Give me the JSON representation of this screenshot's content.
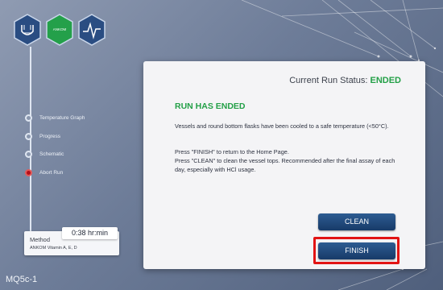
{
  "app": {
    "model": "MQ5c-1",
    "logo_text": "ANKOM"
  },
  "icons": {
    "left": "flask-icon",
    "middle": "ankom-logo-icon",
    "right": "heartbeat-icon"
  },
  "nav": {
    "items": [
      {
        "label": "Temperature Graph",
        "state": "normal"
      },
      {
        "label": "Progress",
        "state": "normal"
      },
      {
        "label": "Schematic",
        "state": "normal"
      },
      {
        "label": "Abort Run",
        "state": "alert"
      }
    ]
  },
  "method": {
    "label": "Method",
    "value": "ANKOM Vitamin A, E, D"
  },
  "time": {
    "value": "0:38 hr:min"
  },
  "panel": {
    "status_label": "Current Run Status:",
    "status_value": "ENDED",
    "title": "RUN HAS ENDED",
    "message_1": "Vessels and round bottom flasks have been cooled to a safe temperature (<50°C).",
    "message_2": "Press \"FINISH\" to return to the Home Page.",
    "message_3": "Press \"CLEAN\" to clean the vessel tops. Recommended after the final assay of each day, especially with HCl usage."
  },
  "buttons": {
    "clean": "CLEAN",
    "finish": "FINISH"
  },
  "colors": {
    "status_green": "#23a047",
    "button_blue": "#1f4677",
    "highlight_red": "#e21414",
    "abort_red": "#b4101a"
  }
}
